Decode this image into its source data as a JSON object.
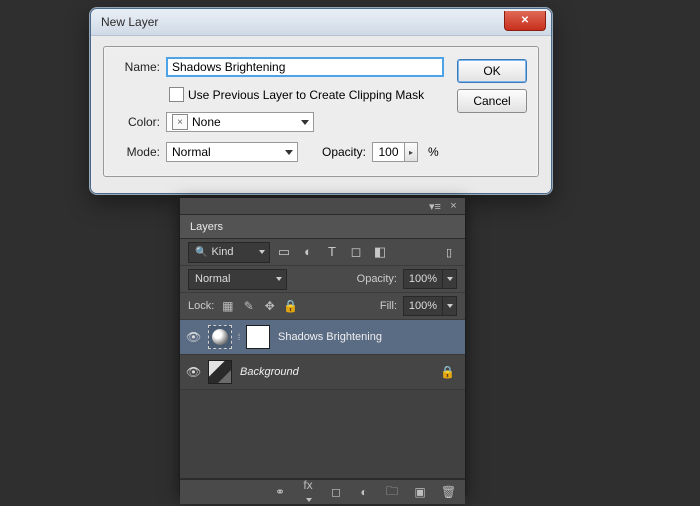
{
  "dialog": {
    "title": "New Layer",
    "name_label": "Name:",
    "name_value": "Shadows Brightening",
    "clip_label": "Use Previous Layer to Create Clipping Mask",
    "clip_checked": false,
    "color_label": "Color:",
    "color_swatch": "×",
    "color_value": "None",
    "mode_label": "Mode:",
    "mode_value": "Normal",
    "opacity_label": "Opacity:",
    "opacity_value": "100",
    "opacity_unit": "%",
    "ok_label": "OK",
    "cancel_label": "Cancel"
  },
  "panel": {
    "tab": "Layers",
    "kind_label": "Kind",
    "filter_icons": [
      "image",
      "adjust",
      "type",
      "shape",
      "smart"
    ],
    "blend_value": "Normal",
    "opacity_label": "Opacity:",
    "opacity_value": "100%",
    "lock_label": "Lock:",
    "fill_label": "Fill:",
    "fill_value": "100%",
    "layers": [
      {
        "name": "Shadows Brightening",
        "type": "adjustment",
        "selected": true,
        "locked": false
      },
      {
        "name": "Background",
        "type": "background",
        "selected": false,
        "locked": true
      }
    ],
    "footer_icons": [
      "link",
      "fx",
      "mask",
      "adjustment",
      "group",
      "new",
      "trash"
    ]
  }
}
